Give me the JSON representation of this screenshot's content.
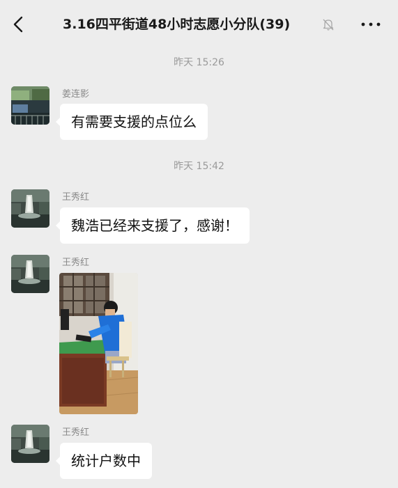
{
  "header": {
    "title": "3.16四平街道48小时志愿小分队(39)"
  },
  "messages": [
    {
      "timestamp": "昨天 15:26",
      "sender": "姜连影",
      "text": "有需要支援的点位么"
    },
    {
      "timestamp": "昨天 15:42",
      "sender": "王秀红",
      "text": "魏浩已经来支援了，感谢！"
    },
    {
      "sender": "王秀红",
      "type": "image"
    },
    {
      "sender": "王秀红",
      "text": "统计户数中"
    }
  ]
}
